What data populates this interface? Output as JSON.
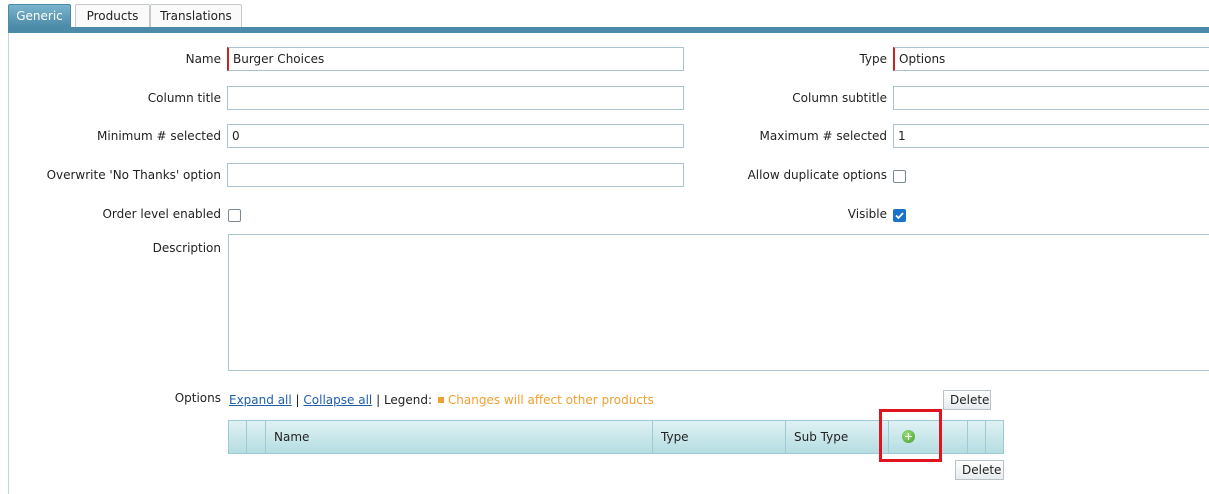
{
  "tabs": [
    {
      "label": "Generic",
      "active": true
    },
    {
      "label": "Products",
      "active": false
    },
    {
      "label": "Translations",
      "active": false
    }
  ],
  "form": {
    "name": {
      "label": "Name",
      "value": "Burger Choices"
    },
    "type": {
      "label": "Type",
      "value": "Options"
    },
    "column_title": {
      "label": "Column title",
      "value": ""
    },
    "column_subtitle": {
      "label": "Column subtitle",
      "value": ""
    },
    "min_selected": {
      "label": "Minimum # selected",
      "value": "0"
    },
    "max_selected": {
      "label": "Maximum # selected",
      "value": "1"
    },
    "overwrite_no_thanks": {
      "label": "Overwrite 'No Thanks' option",
      "value": ""
    },
    "allow_duplicate": {
      "label": "Allow duplicate options",
      "checked": false
    },
    "order_level": {
      "label": "Order level enabled",
      "checked": false
    },
    "visible": {
      "label": "Visible",
      "checked": true
    },
    "description": {
      "label": "Description",
      "value": ""
    }
  },
  "options": {
    "label": "Options",
    "expand_all": "Expand all",
    "separator": "|",
    "collapse_all": "Collapse all",
    "legend_label": "| Legend:",
    "legend_text": "Changes will affect other products",
    "legend_color": "#f0a030",
    "delete_top": "Delete",
    "delete_bottom": "Delete",
    "columns": [
      "Name",
      "Type",
      "Sub Type"
    ],
    "add_icon": "plus-circle-icon"
  },
  "colors": {
    "accent": "#4b8aa8",
    "required": "#cc2222",
    "highlight": "#e0141e"
  }
}
